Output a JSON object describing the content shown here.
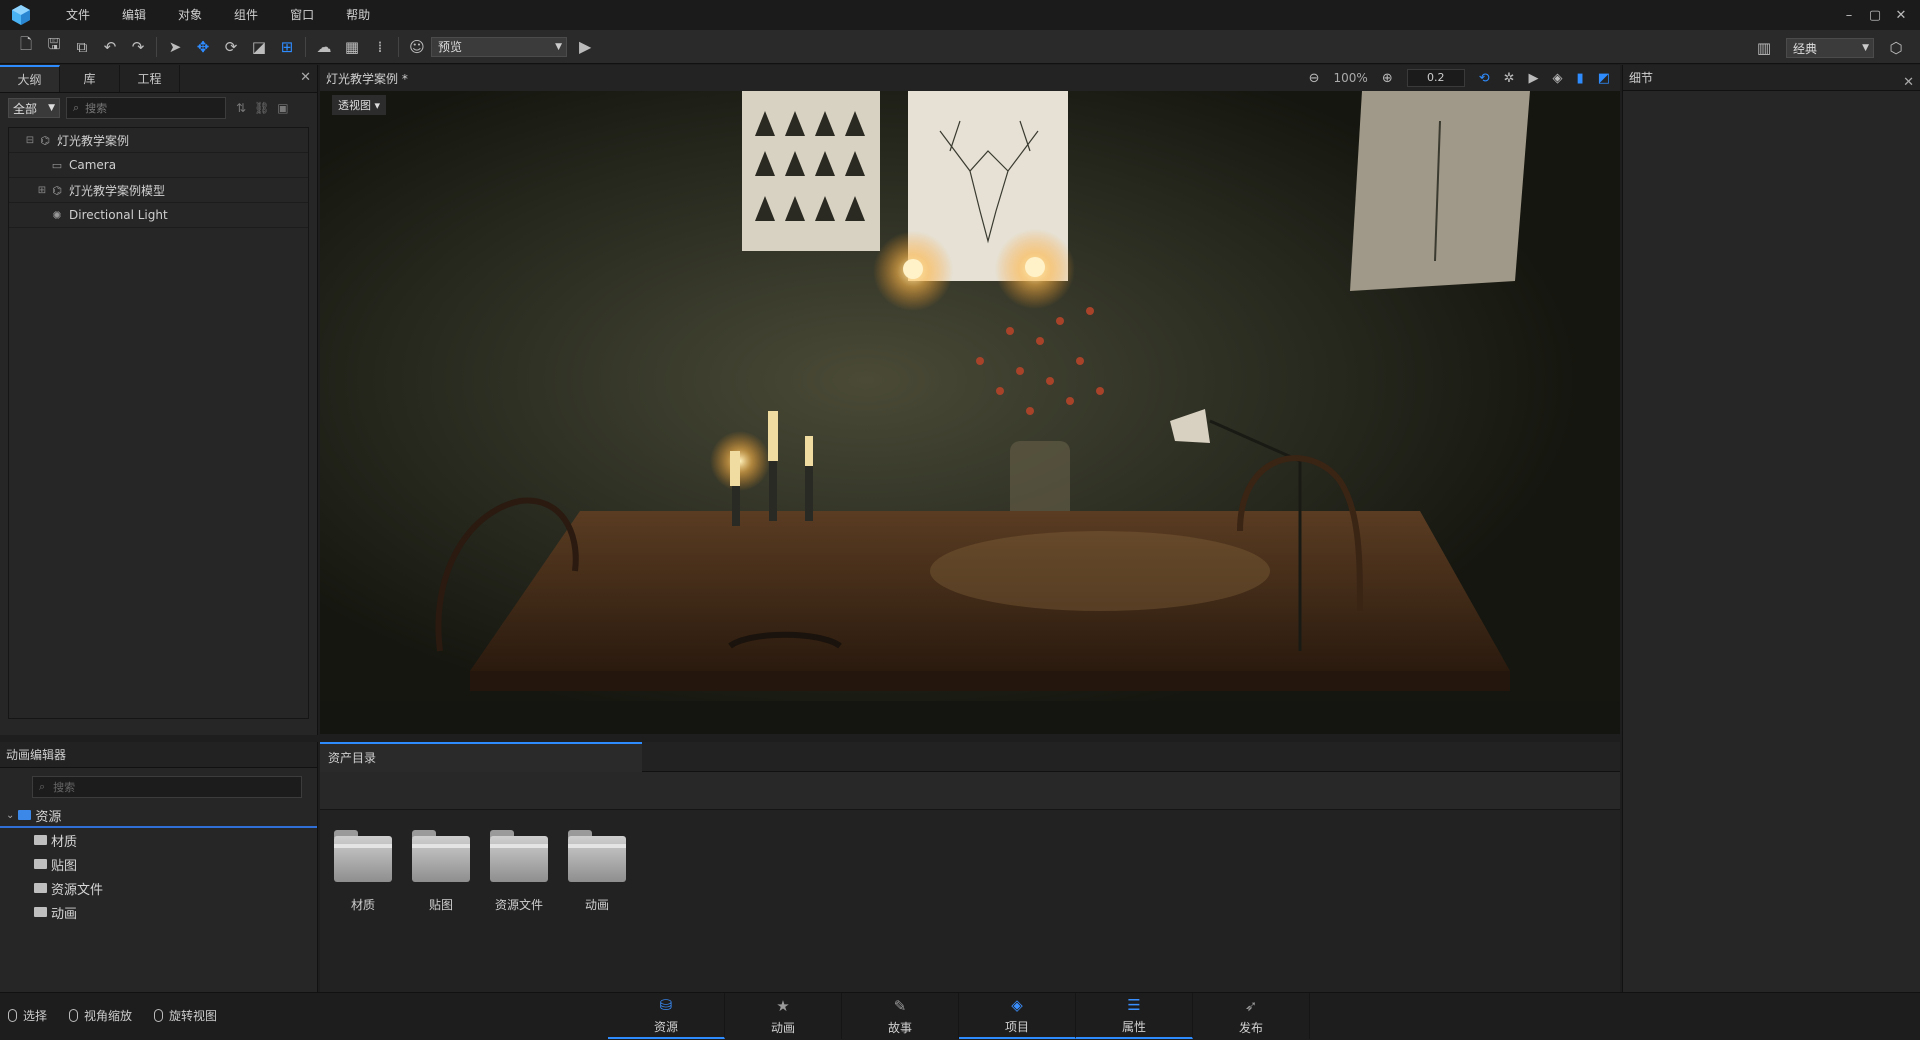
{
  "menu": [
    "文件",
    "编辑",
    "对象",
    "组件",
    "窗口",
    "帮助"
  ],
  "window_controls": [
    "–",
    "▢",
    "✕"
  ],
  "toolbar": {
    "mode_select": "预览",
    "layout_select": "经典"
  },
  "left_panel": {
    "tabs": [
      "大纲",
      "库",
      "工程"
    ],
    "filter": "全部",
    "search_placeholder": "搜索",
    "tree": [
      {
        "label": "灯光教学案例",
        "expander": "⊟",
        "icon": "group-icon",
        "indent": 0
      },
      {
        "label": "Camera",
        "expander": "",
        "icon": "camera-icon",
        "indent": 1
      },
      {
        "label": "灯光教学案例模型",
        "expander": "⊞",
        "icon": "group-icon",
        "indent": 1
      },
      {
        "label": "Directional Light",
        "expander": "",
        "icon": "light-icon",
        "indent": 1
      }
    ]
  },
  "viewport": {
    "title": "灯光教学案例 *",
    "zoom": "100%",
    "speed": "0.2",
    "view_mode": "透视图"
  },
  "right_panel": {
    "title": "细节"
  },
  "anim_editor": {
    "title": "动画编辑器",
    "search_placeholder": "搜索",
    "root": "资源",
    "children": [
      "材质",
      "贴图",
      "资源文件",
      "动画"
    ]
  },
  "asset_dir": {
    "tab": "资产目录",
    "folders": [
      "材质",
      "贴图",
      "资源文件",
      "动画"
    ]
  },
  "status": {
    "hints": [
      "选择",
      "视角缩放",
      "旋转视图"
    ],
    "tabs": [
      {
        "label": "资源",
        "icon": "resource-icon",
        "active": true
      },
      {
        "label": "动画",
        "icon": "animation-icon",
        "active": false
      },
      {
        "label": "故事",
        "icon": "story-icon",
        "active": false
      },
      {
        "label": "项目",
        "icon": "project-icon",
        "active": true
      },
      {
        "label": "属性",
        "icon": "properties-icon",
        "active": true
      },
      {
        "label": "发布",
        "icon": "publish-icon",
        "active": false
      }
    ]
  },
  "colors": {
    "accent": "#2f8cff",
    "panel": "#262626",
    "bar": "#1b1b1b"
  }
}
